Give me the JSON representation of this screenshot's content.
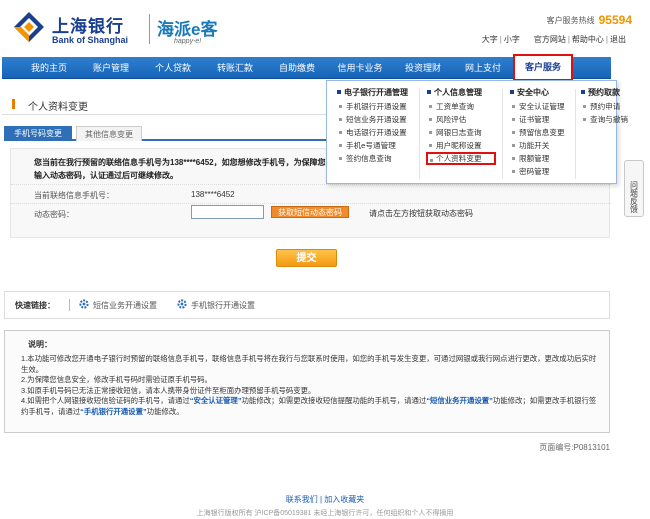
{
  "header": {
    "bank_name_cn": "上海银行",
    "bank_name_en": "Bank of Shanghai",
    "sub_brand_cn": "海派e客",
    "sub_brand_en": "happy-e!",
    "hotline_label": "客户服务热线",
    "hotline_number": "95594",
    "links": {
      "font_large": "大字",
      "font_small": "小字",
      "website": "官方网站",
      "help_center": "帮助中心",
      "logout": "退出"
    },
    "brand_color": "#1b3f8f",
    "accent_color": "#f29400"
  },
  "nav": {
    "items": [
      {
        "label": "我的主页"
      },
      {
        "label": "账户管理"
      },
      {
        "label": "个人贷款"
      },
      {
        "label": "转账汇款"
      },
      {
        "label": "自助缴费"
      },
      {
        "label": "信用卡业务"
      },
      {
        "label": "投资理财"
      },
      {
        "label": "网上支付"
      },
      {
        "label": "客户服务"
      }
    ],
    "active": "客户服务"
  },
  "dropdown": {
    "columns": [
      {
        "header": "电子银行开通管理",
        "items": [
          "手机银行开通设置",
          "短信业务开通设置",
          "电话银行开通设置",
          "手机e号通管理",
          "签约信息查询"
        ]
      },
      {
        "header": "个人信息管理",
        "items": [
          "工资单查询",
          "风险评估",
          "网银日志查询",
          "用户昵称设置",
          "个人资料变更"
        ],
        "selected": "个人资料变更"
      },
      {
        "header": "安全中心",
        "items": [
          "安全认证管理",
          "证书管理",
          "预留信息变更",
          "功能开关",
          "限额管理",
          "密码管理"
        ]
      },
      {
        "header": "预约取款",
        "items": [
          "预约申请",
          "查询与撤销"
        ]
      }
    ]
  },
  "side_tab": {
    "label": "问题反馈"
  },
  "page": {
    "title": "个人资料变更",
    "tabs": [
      "手机号码变更",
      "其他信息变更"
    ],
    "active_tab": "手机号码变更"
  },
  "form": {
    "notice_line1": "您当前在我行预留的联络信息手机号为138****6452，如您想修改手机号，为保障您的信息安全，请点击",
    "notice_line2": "输入动态密码，认证通过后可继续修改。",
    "phone_label": "当前联络信息手机号：",
    "phone_value": "138****6452",
    "otp_label": "动态密码：",
    "otp_value": "",
    "otp_button": "获取短信动态密码",
    "otp_hint": "请点击左方按钮获取动态密码",
    "submit": "提交"
  },
  "quick_links": {
    "label": "快速链接：",
    "links": [
      "短信业务开通设置",
      "手机银行开通设置"
    ]
  },
  "explanation": {
    "title": "说明：",
    "items": [
      {
        "num": "1.",
        "text": "本功能可修改您开通电子银行时预留的联络信息手机号，联络信息手机号将在我行与您联系时使用，如您的手机号发生变更，可通过网银或我行网点进行更改，更改成功后实时生效。"
      },
      {
        "num": "2.",
        "text": "为保障您信息安全，修改手机号码时需验证原手机号码。"
      },
      {
        "num": "3.",
        "text": "如原手机号码已无法正常接收短信，请本人携带身份证件至柜面办理预留手机号码变更。"
      },
      {
        "num": "4.",
        "pre": "如需把个人网银接收短信验证码的手机号，请通过",
        "link1": "“安全认证管理”",
        "mid1": "功能修改；如需更改接收短信提醒功能的手机号，请通过",
        "link2": "“短信业务开通设置”",
        "mid2": "功能修改；如需更改手机银行签约手机号，请通过",
        "link3": "“手机银行开通设置”",
        "post": "功能修改。"
      }
    ]
  },
  "page_number": "页面编号:P0813101",
  "footer": {
    "contact": "联系我们",
    "favorite": "加入收藏夹",
    "copyright": "上海银行版权所有 沪ICP备05019381 未经上海银行许可，任何组织和个人不得摘用"
  }
}
